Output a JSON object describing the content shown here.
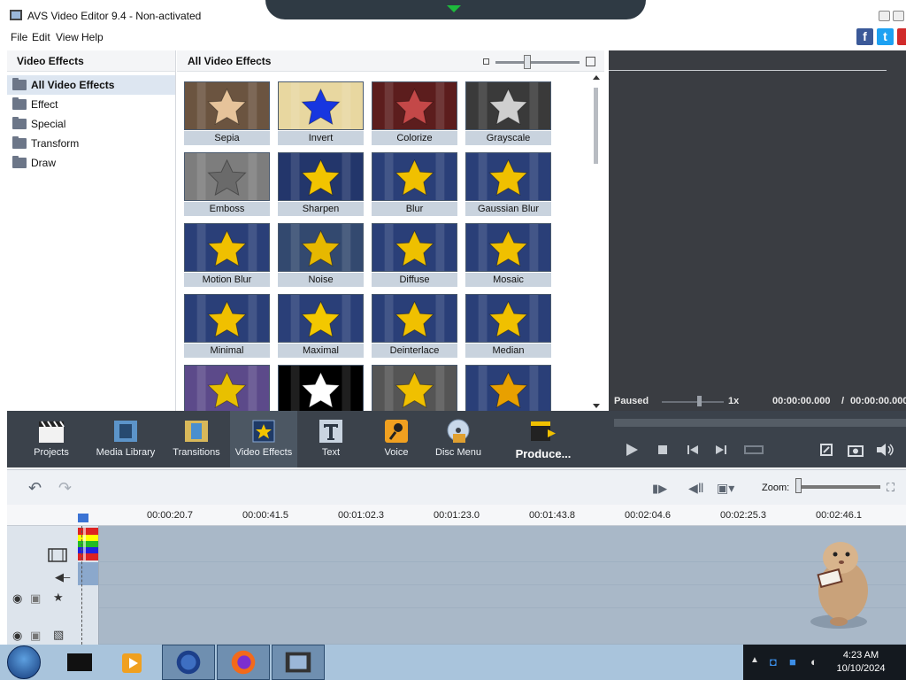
{
  "window": {
    "title": "AVS Video Editor 9.4 - Non-activated"
  },
  "menu": {
    "items": [
      "File",
      "Edit",
      "View",
      "Help"
    ]
  },
  "social": {
    "facebook": "f",
    "twitter": "t",
    "youtube": ""
  },
  "left_panel": {
    "title": "Video Effects",
    "items": [
      "All Video Effects",
      "Effect",
      "Special",
      "Transform",
      "Draw"
    ],
    "selected": "All Video Effects"
  },
  "grid_panel": {
    "title": "All Video Effects",
    "tiles": [
      {
        "label": "Sepia",
        "icon": "star-sepia",
        "bg": "#6b5440",
        "star": "#e6c39a"
      },
      {
        "label": "Invert",
        "icon": "star-inverted",
        "bg": "#e8d7a0",
        "star": "#1736e0"
      },
      {
        "label": "Colorize",
        "icon": "star-colorized",
        "bg": "#5c1d1d",
        "star": "#c44848"
      },
      {
        "label": "Grayscale",
        "icon": "star-grayscale",
        "bg": "#3a3a3a",
        "star": "#cfcfcf"
      },
      {
        "label": "Emboss",
        "icon": "star-emboss",
        "bg": "#7d7d7d",
        "star": "#6a6a6a"
      },
      {
        "label": "Sharpen",
        "icon": "star-sharpened",
        "bg": "#23366b",
        "star": "#f2c400"
      },
      {
        "label": "Blur",
        "icon": "star-blurred",
        "bg": "#2a3f78",
        "star": "#f0c000"
      },
      {
        "label": "Gaussian Blur",
        "icon": "star-gaussian",
        "bg": "#2a3f78",
        "star": "#f0c000"
      },
      {
        "label": "Motion Blur",
        "icon": "star-motion",
        "bg": "#2a3f78",
        "star": "#f0c000"
      },
      {
        "label": "Noise",
        "icon": "star-noise",
        "bg": "#33496f",
        "star": "#e6b800"
      },
      {
        "label": "Diffuse",
        "icon": "star-diffuse",
        "bg": "#2a3f78",
        "star": "#eec000"
      },
      {
        "label": "Mosaic",
        "icon": "star-mosaic",
        "bg": "#2a3f78",
        "star": "#f0c000"
      },
      {
        "label": "Minimal",
        "icon": "star-minimal",
        "bg": "#2a3f78",
        "star": "#f0c000"
      },
      {
        "label": "Maximal",
        "icon": "star-maximal",
        "bg": "#2a3f78",
        "star": "#f3c800"
      },
      {
        "label": "Deinterlace",
        "icon": "star-deinterlace",
        "bg": "#2a3f78",
        "star": "#f0c000"
      },
      {
        "label": "Median",
        "icon": "star-median",
        "bg": "#2a3f78",
        "star": "#f0c000"
      },
      {
        "label": "",
        "icon": "star-pencil",
        "bg": "#5c4a8a",
        "star": "#e8c000"
      },
      {
        "label": "",
        "icon": "star-threshold",
        "bg": "#000000",
        "star": "#ffffff"
      },
      {
        "label": "",
        "icon": "star-dark",
        "bg": "#555555",
        "star": "#f0c000"
      },
      {
        "label": "",
        "icon": "star-red",
        "bg": "#2a3f78",
        "star": "#e8a000"
      }
    ]
  },
  "preview": {
    "status": "Paused",
    "speed": "1x",
    "current_time": "00:00:00.000",
    "separator": "/",
    "total_time": "00:00:00.000"
  },
  "toolbar": {
    "items": [
      {
        "label": "Projects",
        "icon": "clapperboard-icon"
      },
      {
        "label": "Media Library",
        "icon": "film-strip-icon"
      },
      {
        "label": "Transitions",
        "icon": "transition-icon"
      },
      {
        "label": "Video Effects",
        "icon": "star-effects-icon"
      },
      {
        "label": "Text",
        "icon": "text-t-icon"
      },
      {
        "label": "Voice",
        "icon": "microphone-icon"
      },
      {
        "label": "Disc Menu",
        "icon": "disc-icon"
      },
      {
        "label": "Produce...",
        "icon": "produce-icon"
      }
    ],
    "active": "Video Effects"
  },
  "timeline": {
    "zoom_label": "Zoom:",
    "ticks": [
      "00:00:20.7",
      "00:00:41.5",
      "00:01:02.3",
      "00:01:23.0",
      "00:01:43.8",
      "00:02:04.6",
      "00:02:25.3",
      "00:02:46.1"
    ]
  },
  "taskbar": {
    "time": "4:23 AM",
    "date": "10/10/2024"
  },
  "colors": {
    "toolbar_bg": "#3b424b",
    "preview_bg": "#3a3d42",
    "tile_label_bg": "#c9d3de",
    "accent": "#3b73d4"
  }
}
